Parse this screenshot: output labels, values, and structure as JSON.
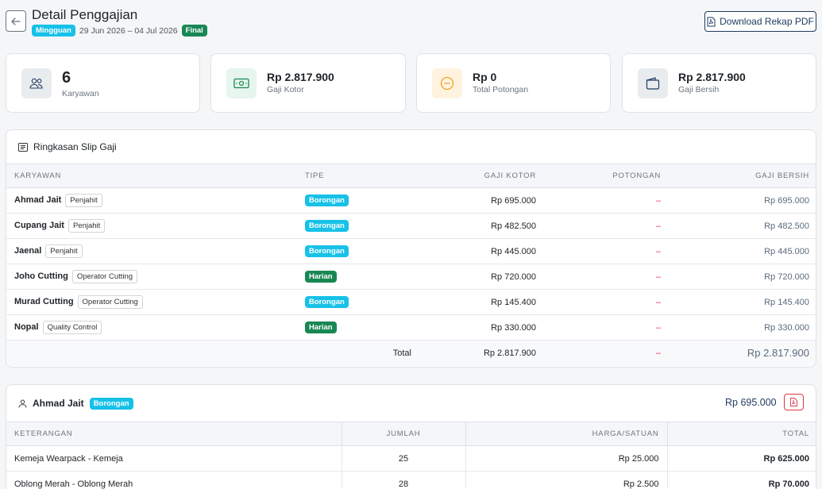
{
  "header": {
    "title": "Detail Penggajian",
    "period_type": "Mingguan",
    "period_range": "29 Jun 2026 – 04 Jul 2026",
    "status": "Final",
    "download_label": "Download Rekap PDF"
  },
  "stats": [
    {
      "value": "6",
      "label": "Karyawan",
      "icon": "people-icon",
      "color": "#e9ecef"
    },
    {
      "value": "Rp 2.817.900",
      "label": "Gaji Kotor",
      "icon": "cash-icon",
      "color": "#e6f6ee"
    },
    {
      "value": "Rp 0",
      "label": "Total Potongan",
      "icon": "minus-circle-icon",
      "color": "#fff3e0"
    },
    {
      "value": "Rp 2.817.900",
      "label": "Gaji Bersih",
      "icon": "wallet-icon",
      "color": "#e9ecef"
    }
  ],
  "summary": {
    "title": "Ringkasan Slip Gaji",
    "columns": [
      "Karyawan",
      "Tipe",
      "Gaji Kotor",
      "Potongan",
      "Gaji Bersih"
    ],
    "rows": [
      {
        "name": "Ahmad Jait",
        "role": "Penjahit",
        "type": "Borongan",
        "gross": "Rp 695.000",
        "deduction": "–",
        "net": "Rp 695.000"
      },
      {
        "name": "Cupang Jait",
        "role": "Penjahit",
        "type": "Borongan",
        "gross": "Rp 482.500",
        "deduction": "–",
        "net": "Rp 482.500"
      },
      {
        "name": "Jaenal",
        "role": "Penjahit",
        "type": "Borongan",
        "gross": "Rp 445.000",
        "deduction": "–",
        "net": "Rp 445.000"
      },
      {
        "name": "Joho Cutting",
        "role": "Operator Cutting",
        "type": "Harian",
        "gross": "Rp 720.000",
        "deduction": "–",
        "net": "Rp 720.000"
      },
      {
        "name": "Murad Cutting",
        "role": "Operator Cutting",
        "type": "Borongan",
        "gross": "Rp 145.400",
        "deduction": "–",
        "net": "Rp 145.400"
      },
      {
        "name": "Nopal",
        "role": "Quality Control",
        "type": "Harian",
        "gross": "Rp 330.000",
        "deduction": "–",
        "net": "Rp 330.000"
      }
    ],
    "total_label": "Total",
    "total_gross": "Rp 2.817.900",
    "total_deduction": "–",
    "total_net": "Rp 2.817.900"
  },
  "detail": {
    "name": "Ahmad Jait",
    "type": "Borongan",
    "amount": "Rp 695.000",
    "columns": [
      "Keterangan",
      "Jumlah",
      "Harga/Satuan",
      "Total"
    ],
    "rows": [
      {
        "desc": "Kemeja Wearpack - Kemeja",
        "qty": "25",
        "price": "Rp 25.000",
        "total": "Rp 625.000"
      },
      {
        "desc": "Oblong Merah - Oblong Merah",
        "qty": "28",
        "price": "Rp 2.500",
        "total": "Rp 70.000"
      }
    ]
  },
  "colors": {
    "borongan": "#17c1e8",
    "harian": "#198754",
    "final": "#198754",
    "accent": "#1e3a5f",
    "danger": "#dc3545"
  }
}
